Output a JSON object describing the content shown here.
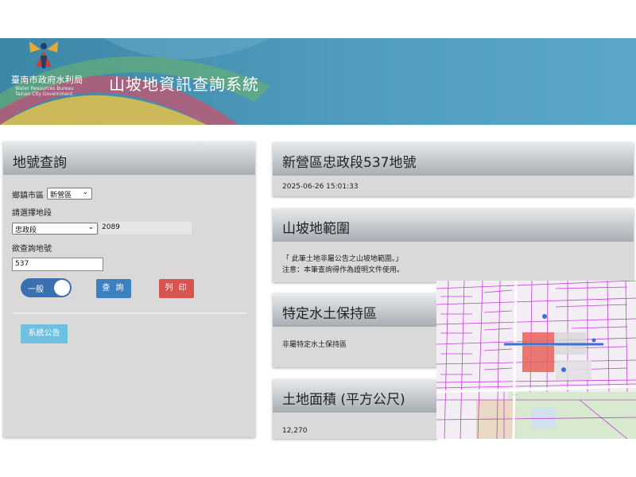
{
  "header": {
    "org_name": "臺南市政府水利局",
    "org_en_line1": "Water Resources Bureau",
    "org_en_line2": "Tainan City Government",
    "site_title": "山坡地資訊查詢系統"
  },
  "search_panel": {
    "title": "地號查詢",
    "district_label": "鄉鎮市區",
    "district_value": "新營區",
    "section_label": "請選擇地段",
    "section_value": "忠政段",
    "section_code": "2089",
    "parcel_label": "欲查詢地號",
    "parcel_value": "537",
    "toggle_label": "一般",
    "query_button": "查 詢",
    "print_button": "列 印",
    "notice_button": "系統公告"
  },
  "result": {
    "parcel_title": "新營區忠政段537地號",
    "timestamp": "2025-06-26 15:01:33",
    "slope_title": "山坡地範圍",
    "slope_line1": "「 此筆土地非屬公告之山坡地範圍。」",
    "slope_line2": "注意：本筆查詢得作為證明文件使用。",
    "soil_title": "特定水土保持區",
    "soil_text": "非屬特定水土保持區",
    "area_title": "土地面積 (平方公尺)",
    "area_value": "12,270"
  },
  "colors": {
    "header_blue": "#4f9cbd",
    "toggle_blue": "#3a6fb0",
    "query_blue": "#3f7fc0",
    "print_red": "#d9534f",
    "notice_blue": "#6fbfe0",
    "map_parcel_line": "#c23fd6",
    "map_highlight": "#e8605a"
  },
  "icons": [
    "bureau-logo-icon",
    "chevron-down-icon"
  ]
}
